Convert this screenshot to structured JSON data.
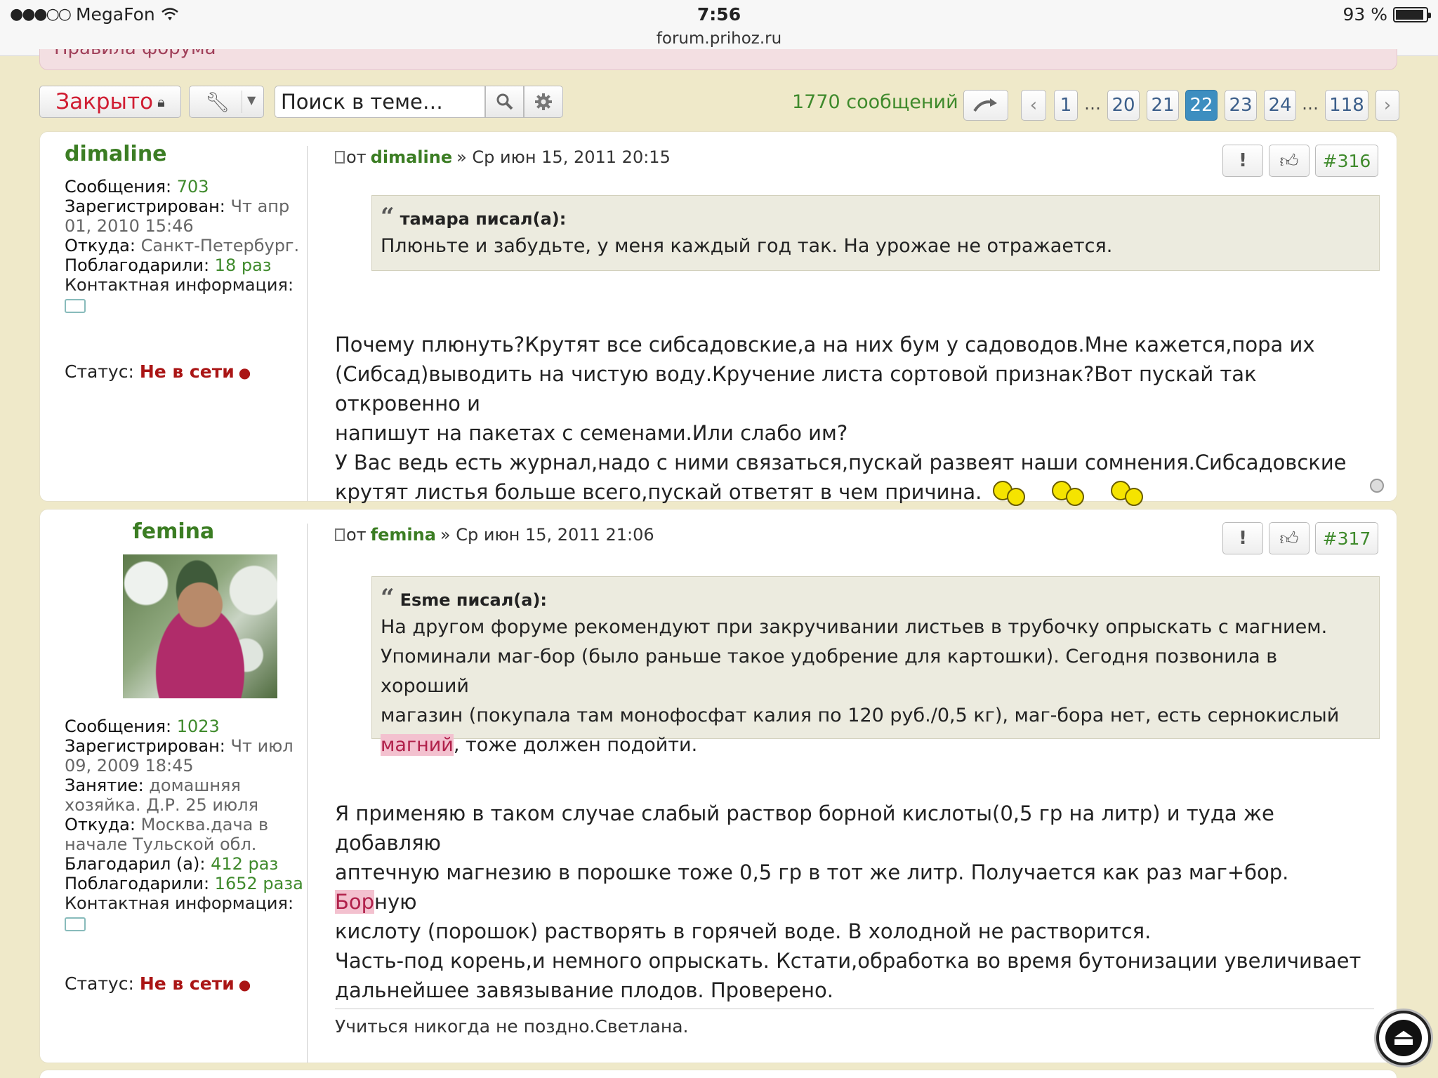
{
  "statusbar": {
    "carrier": "MegaFon",
    "time": "7:56",
    "url": "forum.prihoz.ru",
    "battery": "93 %",
    "battery_level_pct": 93
  },
  "rules_link": "Правила форума",
  "toolbar": {
    "closed_label": "Закрыто",
    "search_placeholder": "Поиск в теме…",
    "post_count": "1770 сообщений",
    "pages": {
      "first": "1",
      "ellipsis": "…",
      "p20": "20",
      "p21": "21",
      "current": "22",
      "p23": "23",
      "p24": "24",
      "last": "118"
    }
  },
  "posts": [
    {
      "author": "dimaline",
      "profile": {
        "messages_label": "Сообщения:",
        "messages": "703",
        "registered_label": "Зарегистрирован:",
        "registered": "Чт апр 01, 2010 15:46",
        "from_label": "Откуда:",
        "from": "Санкт-Петербург.",
        "thanked_label": "Поблагодарили:",
        "thanked": "18 раз",
        "contact_label": "Контактная информация:",
        "status_label": "Статус:",
        "status": "Не в сети"
      },
      "head_prefix": "от",
      "date": "» Ср июн 15, 2011 20:15",
      "number": "#316",
      "quote": {
        "author": "тамара писал(а):",
        "text": "Плюньте и забудьте, у меня каждый год так. На урожае не отражается."
      },
      "body_lines": [
        "Почему плюнуть?Крутят все сибсадовские,а на них бум у садоводов.Мне кажется,пора их",
        "(Сибсад)выводить на чистую воду.Кручение листа сортовой признак?Вот пускай так откровенно и",
        "напишут на пакетах с семенами.Или слабо им?",
        "У Вас ведь есть журнал,надо с ними связаться,пускай развеят наши сомнения.Сибсадовские",
        "крутят листья больше всего,пускай ответят в чем причина."
      ]
    },
    {
      "author": "femina",
      "profile": {
        "messages_label": "Сообщения:",
        "messages": "1023",
        "registered_label": "Зарегистрирован:",
        "registered": "Чт июл 09, 2009 18:45",
        "occupation_label": "Занятие:",
        "occupation": "домашняя хозяйка. Д.Р. 25 июля",
        "from_label": "Откуда:",
        "from": "Москва.дача в начале Тульской обл.",
        "gave_thanks_label": "Благодарил (а):",
        "gave_thanks": "412 раз",
        "thanked_label": "Поблагодарили:",
        "thanked": "1652 раза",
        "contact_label": "Контактная информация:",
        "status_label": "Статус:",
        "status": "Не в сети"
      },
      "head_prefix": "от",
      "date": "» Ср июн 15, 2011 21:06",
      "number": "#317",
      "quote": {
        "author": "Esme писал(а):",
        "line1": "На другом форуме рекомендуют при закручивании листьев в трубочку опрыскать с магнием.",
        "line2": "Упоминали маг-бор (было раньше такое удобрение для картошки). Сегодня позвонила в хороший",
        "line3": "магазин (покупала там монофосфат калия по 120 руб./0,5 кг), маг-бора нет, есть сернокислый",
        "line4_hl": "магний",
        "line4_rest": ", тоже должен подойти."
      },
      "body": {
        "line1": "Я применяю в таком случае слабый раствор борной кислоты(0,5 гр на литр) и туда же добавляю",
        "line2_a": "аптечную магнезию в порошке тоже 0,5 гр в тот же литр. Получается как раз маг+бор. ",
        "line2_hl": "Бор",
        "line2_b": "ную",
        "line3": "кислоту (порошок) растворять в горячей воде. В холодной не растворится.",
        "line4": "Часть-под корень,и немного опрыскать. Кстати,обработка во время бутонизации увеличивает",
        "line5": "дальнейшее завязывание плодов. Проверено."
      },
      "signature": "Учиться никогда не поздно.Светлана."
    }
  ],
  "icons": {
    "wifi": "wifi-icon",
    "lock": "lock-icon",
    "wrench": "wrench-icon",
    "search": "search-icon",
    "gear": "gear-icon",
    "jump": "jump-to-page-icon",
    "thumb": "thumbs-up-icon",
    "report": "report-icon"
  },
  "colors": {
    "accent_green": "#3f8a2c",
    "closed_red": "#d01d32",
    "active_page": "#3d8ec0",
    "offline_red": "#aa1515"
  }
}
